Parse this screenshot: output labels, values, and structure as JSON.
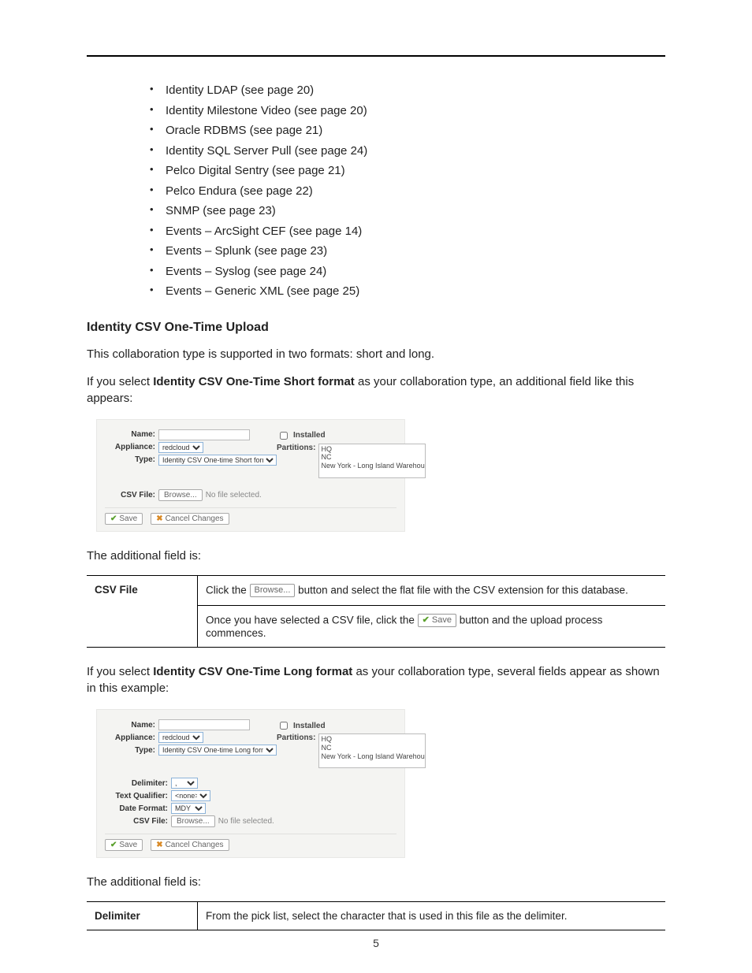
{
  "bullets": [
    "Identity LDAP (see page 20)",
    "Identity Milestone Video (see page 20)",
    "Oracle RDBMS (see page 21)",
    "Identity SQL Server Pull (see page 24)",
    "Pelco Digital Sentry (see page 21)",
    "Pelco Endura (see page 22)",
    "SNMP (see page 23)",
    "Events – ArcSight CEF (see page 14)",
    "Events – Splunk (see page 23)",
    "Events – Syslog (see page 24)",
    "Events – Generic XML (see page 25)"
  ],
  "heading": "Identity CSV One-Time Upload",
  "intro": "This collaboration type is supported in two formats: short and long.",
  "short_p1_a": "If you select ",
  "short_p1_b": "Identity CSV One-Time Short format",
  "short_p1_c": " as your collaboration type, an additional field like this appears:",
  "fig_common": {
    "name_lbl": "Name:",
    "appliance_lbl": "Appliance:",
    "appliance_val": "redcloud",
    "type_lbl": "Type:",
    "installed_lbl": "Installed",
    "partitions_lbl": "Partitions:",
    "partitions": [
      "HQ",
      "NC",
      "New York - Long Island Warehouse"
    ],
    "csvfile_lbl": "CSV File:",
    "browse": "Browse...",
    "nofile": "No file selected.",
    "save": "Save",
    "cancel": "Cancel Changes"
  },
  "fig_short_type": "Identity CSV One-time Short format",
  "fig_long_type": "Identity CSV One-time Long format",
  "fig_long": {
    "delimiter_lbl": "Delimiter:",
    "delimiter_val": ",",
    "textq_lbl": "Text Qualifier:",
    "textq_val": "<none>",
    "datef_lbl": "Date Format:",
    "datef_val": "MDY"
  },
  "add_field_intro": "The additional field is:",
  "tbl1": {
    "head": "CSV File",
    "r1a": "Click the ",
    "r1b": " button and select the flat file with the CSV extension for this database.",
    "r2a": "Once you have selected a CSV file, click the ",
    "r2b": " button and the upload process commences."
  },
  "long_p_a": "If you select ",
  "long_p_b": "Identity CSV One-Time Long format",
  "long_p_c": " as your collaboration type, several fields appear as shown in this example:",
  "tbl2": {
    "head": "Delimiter",
    "body": "From the pick list, select the character that is used in this file as the delimiter."
  },
  "page_no": "5"
}
